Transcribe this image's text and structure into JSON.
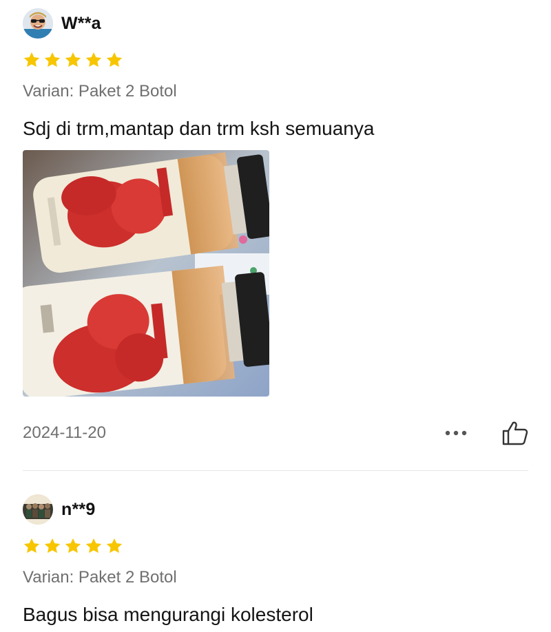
{
  "reviews": [
    {
      "username": "W**a",
      "rating": 5,
      "variant": "Varian: Paket 2 Botol",
      "comment": "Sdj di trm,mantap dan trm ksh semuanya",
      "date": "2024-11-20",
      "has_photo": true
    },
    {
      "username": "n**9",
      "rating": 5,
      "variant": "Varian: Paket 2 Botol",
      "comment": "Bagus bisa mengurangi kolesterol"
    }
  ],
  "colors": {
    "star": "#F7C600",
    "secondary_text": "#6F6F6F",
    "divider": "#E6E6E6"
  },
  "icons": {
    "rating": "star-icon",
    "more": "more-options-icon",
    "like": "thumbs-up-icon"
  }
}
